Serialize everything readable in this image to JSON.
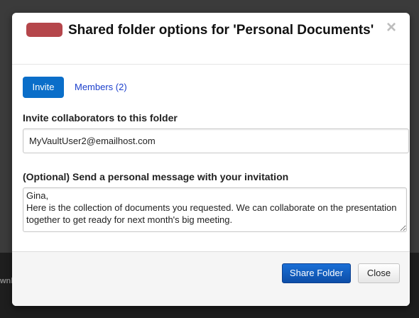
{
  "background": {
    "partial_text": "wnl"
  },
  "dialog": {
    "title": "Shared folder options for 'Personal Documents'",
    "close_icon": "×",
    "badge_color": "#b5464b"
  },
  "tabs": {
    "invite": "Invite",
    "members": "Members (2)"
  },
  "invite_section": {
    "label": "Invite collaborators to this folder",
    "email_value": "MyVaultUser2@emailhost.com"
  },
  "message_section": {
    "label": "(Optional) Send a personal message with your invitation",
    "message_value": "Gina,\nHere is the collection of documents you requested. We can collaborate on the presentation together to get ready for next month's big meeting."
  },
  "footer": {
    "share_label": "Share Folder",
    "close_label": "Close"
  },
  "colors": {
    "primary": "#0a6ec9",
    "link": "#1b3fcc"
  }
}
